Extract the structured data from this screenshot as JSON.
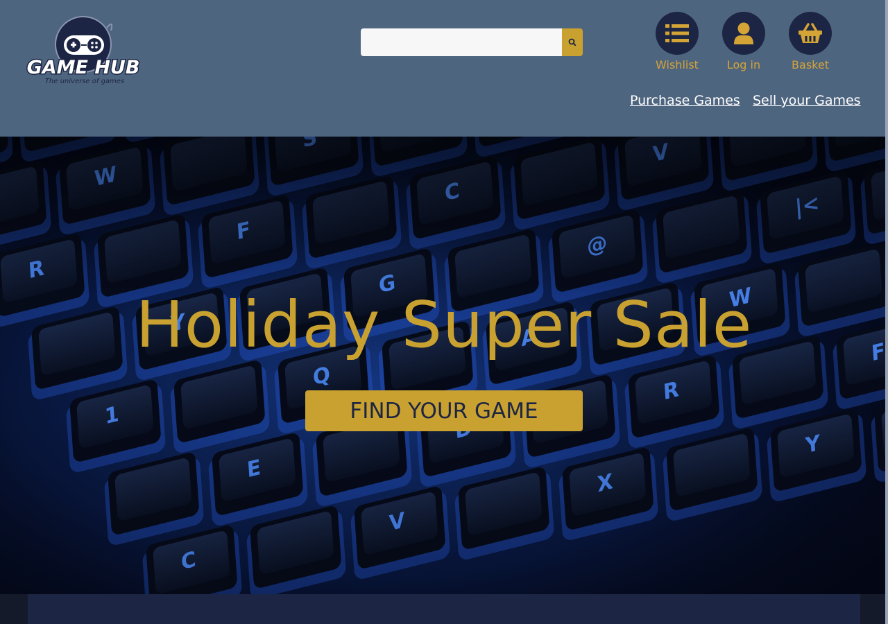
{
  "brand": {
    "name": "GAME HUB",
    "tagline": "The universe of games"
  },
  "search": {
    "placeholder": "",
    "value": "",
    "icon": "search-icon"
  },
  "actions": [
    {
      "label": "Wishlist",
      "icon": "list-icon"
    },
    {
      "label": "Log in",
      "icon": "user-icon"
    },
    {
      "label": "Basket",
      "icon": "basket-icon"
    }
  ],
  "nav": {
    "purchase": "Purchase Games",
    "sell": "Sell your Games"
  },
  "hero": {
    "title": "Holiday Super Sale",
    "cta": "FIND YOUR GAME",
    "keys": [
      "1",
      "Q",
      "A",
      "W",
      "S",
      "E",
      "D",
      "R",
      "F",
      "C",
      "V",
      "X",
      "Y",
      "G",
      "@",
      "|<"
    ]
  },
  "colors": {
    "header_bg": "#4e6580",
    "accent": "#c9a130",
    "navy": "#1c2543"
  }
}
